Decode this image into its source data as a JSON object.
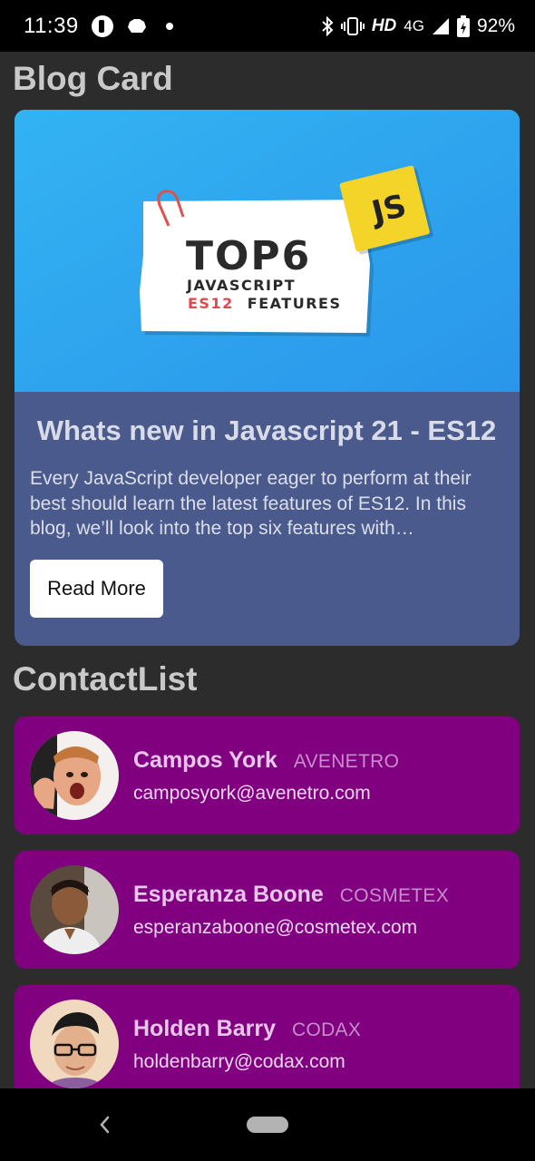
{
  "status_bar": {
    "time": "11:39",
    "network_hd": "HD",
    "network_gen": "4G",
    "battery_percent": "92%"
  },
  "blog_section": {
    "heading": "Blog Card",
    "card": {
      "image": {
        "note_title": "TOP6",
        "note_line1": "JAVASCRIPT",
        "note_line2_accent": "ES12",
        "note_line2_rest": "FEATURES",
        "sticker": "JS"
      },
      "title": "Whats new in Javascript 21 - ES12",
      "description": "Every JavaScript developer eager to perform at their best should learn the latest features of ES12. In this blog, we’ll look into the top six features with…",
      "button_label": "Read More"
    }
  },
  "contact_section": {
    "heading": "ContactList",
    "contacts": [
      {
        "name": "Campos York",
        "company": "AVENETRO",
        "email": "camposyork@avenetro.com"
      },
      {
        "name": "Esperanza Boone",
        "company": "COSMETEX",
        "email": "esperanzaboone@cosmetex.com"
      },
      {
        "name": "Holden Barry",
        "company": "CODAX",
        "email": "holdenbarry@codax.com"
      }
    ]
  },
  "colors": {
    "page_bg": "#2c2c2c",
    "blog_card_bg": "#4a5a8c",
    "blog_image_bg": "#2fa3f0",
    "contact_card_bg": "#800080"
  }
}
